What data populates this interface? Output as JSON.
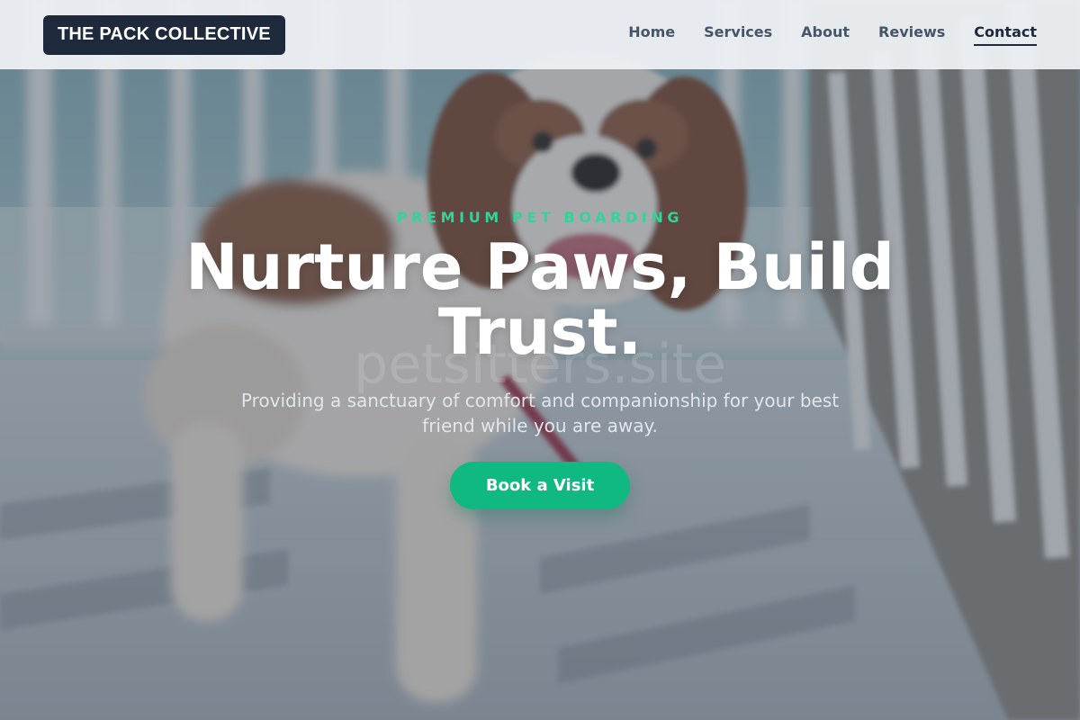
{
  "brand": {
    "name": "THE PACK COLLECTIVE"
  },
  "nav": {
    "items": [
      {
        "label": "Home",
        "active": false
      },
      {
        "label": "Services",
        "active": false
      },
      {
        "label": "About",
        "active": false
      },
      {
        "label": "Reviews",
        "active": false
      },
      {
        "label": "Contact",
        "active": true
      }
    ]
  },
  "hero": {
    "eyebrow": "PREMIUM PET BOARDING",
    "title": "Nurture Paws, Build Trust.",
    "watermark": "petsitters.site",
    "subtitle": "Providing a sanctuary of comfort and companionship for your best friend while you are away.",
    "cta_label": "Book a Visit",
    "image_subject": "dog-photo"
  },
  "colors": {
    "brand_dark": "#1e293b",
    "accent_green": "#10b981",
    "eyebrow_green": "#34d399",
    "header_bg": "#eceff3"
  }
}
